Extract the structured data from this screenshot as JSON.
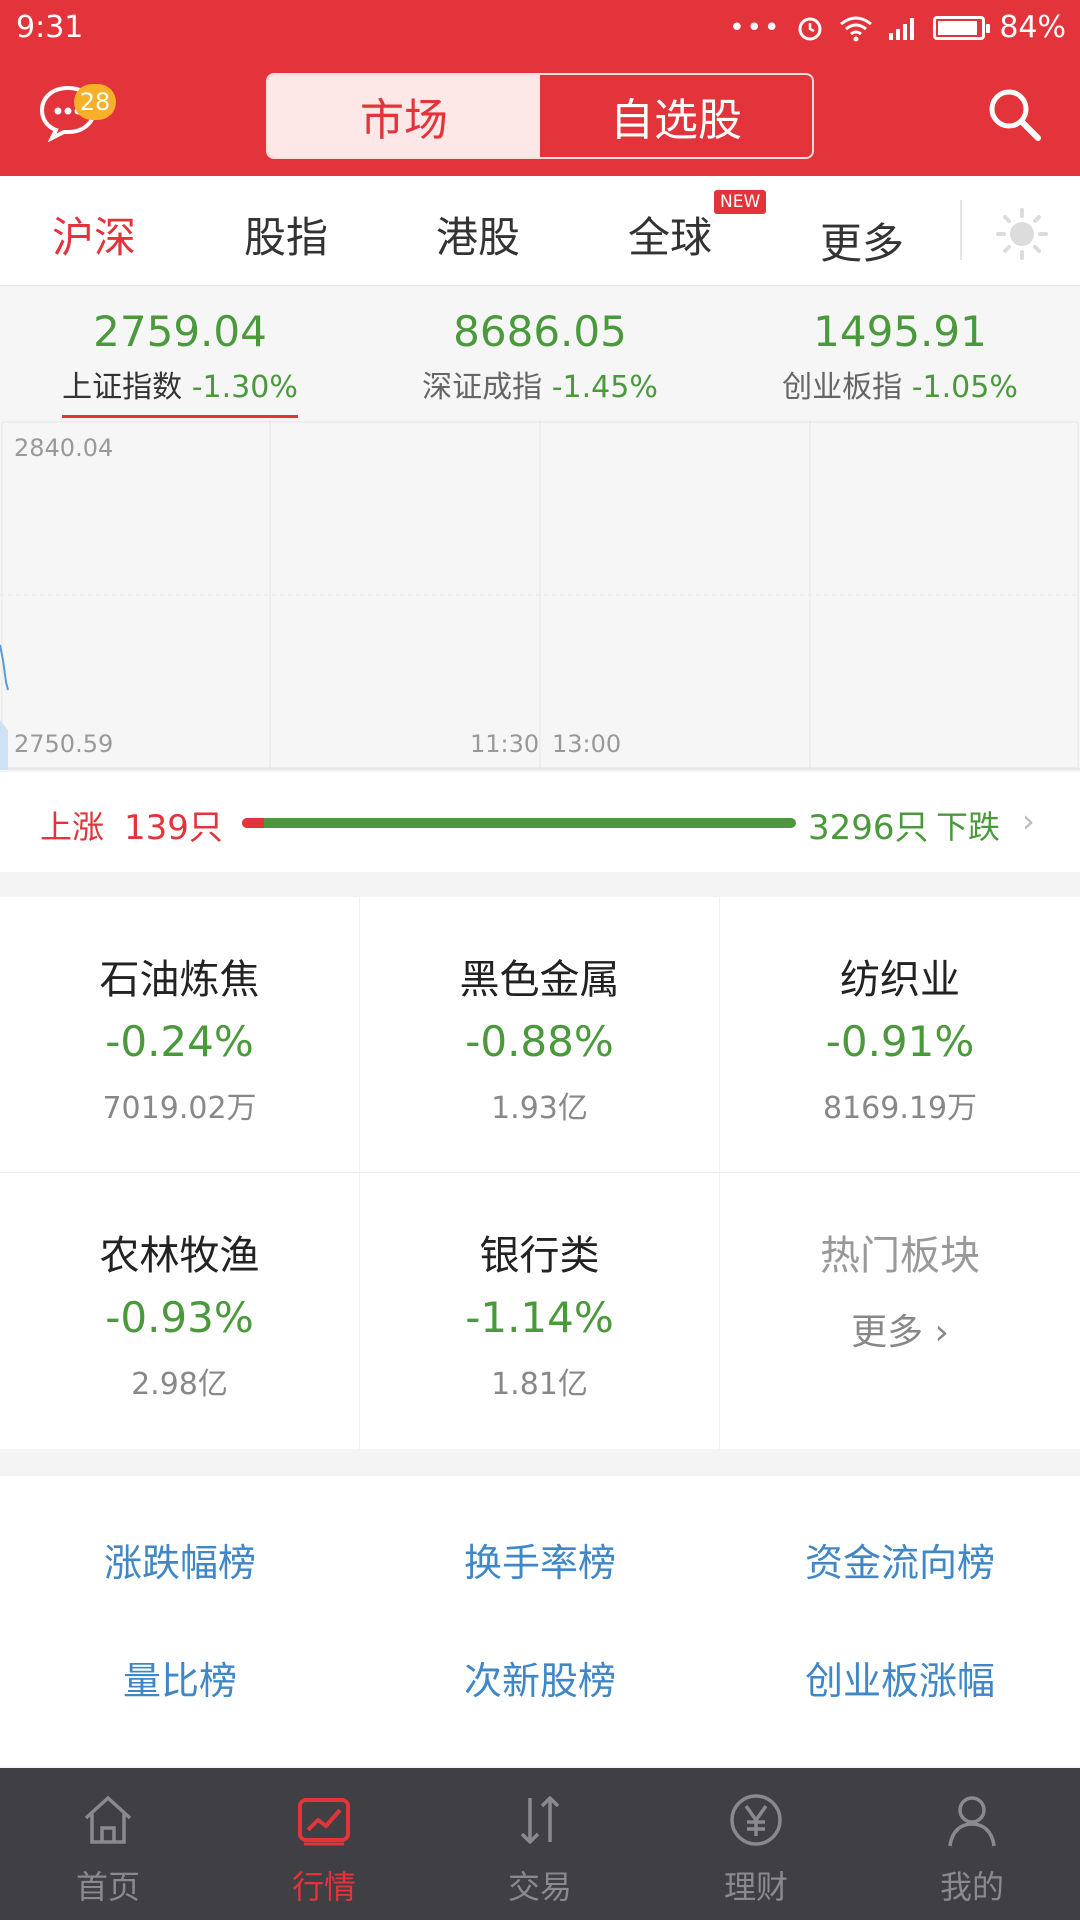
{
  "status_bar": {
    "time": "9:31",
    "battery": "84%"
  },
  "header": {
    "message_badge": "28",
    "segments": [
      "市场",
      "自选股"
    ]
  },
  "tabs": [
    {
      "label": "沪深",
      "active": true
    },
    {
      "label": "股指",
      "active": false
    },
    {
      "label": "港股",
      "active": false
    },
    {
      "label": "全球",
      "active": false,
      "badge": "NEW"
    },
    {
      "label": "更多",
      "active": false
    }
  ],
  "indices": [
    {
      "value": "2759.04",
      "name": "上证指数",
      "change": "-1.30%"
    },
    {
      "value": "8686.05",
      "name": "深证成指",
      "change": "-1.45%"
    },
    {
      "value": "1495.91",
      "name": "创业板指",
      "change": "-1.05%"
    }
  ],
  "chart": {
    "y_top_label": "2840.04",
    "y_bottom_label": "2750.59",
    "time_labels": [
      "11:30",
      "13:00"
    ]
  },
  "breadth": {
    "up_label": "上涨",
    "up_count": "139只",
    "down_count": "3296只",
    "down_label": "下跌",
    "up_value": 139,
    "down_value": 3296
  },
  "sectors": [
    {
      "name": "石油炼焦",
      "change": "-0.24%",
      "amount": "7019.02万"
    },
    {
      "name": "黑色金属",
      "change": "-0.88%",
      "amount": "1.93亿"
    },
    {
      "name": "纺织业",
      "change": "-0.91%",
      "amount": "8169.19万"
    },
    {
      "name": "农林牧渔",
      "change": "-0.93%",
      "amount": "2.98亿"
    },
    {
      "name": "银行类",
      "change": "-1.14%",
      "amount": "1.81亿"
    }
  ],
  "hot_sectors": {
    "title": "热门板块",
    "more": "更多 ›"
  },
  "rankings": [
    "涨跌幅榜",
    "换手率榜",
    "资金流向榜",
    "量比榜",
    "次新股榜",
    "创业板涨幅"
  ],
  "bottom_nav": [
    {
      "label": "首页",
      "icon": "home-icon",
      "active": false
    },
    {
      "label": "行情",
      "icon": "market-chart-icon",
      "active": true
    },
    {
      "label": "交易",
      "icon": "trade-arrows-icon",
      "active": false
    },
    {
      "label": "理财",
      "icon": "yen-icon",
      "active": false
    },
    {
      "label": "我的",
      "icon": "user-icon",
      "active": false
    }
  ],
  "colors": {
    "brand_red": "#e2343a",
    "down_green": "#4a9a3c",
    "link_blue": "#3f87c7",
    "nav_bg": "#3f3f44"
  }
}
